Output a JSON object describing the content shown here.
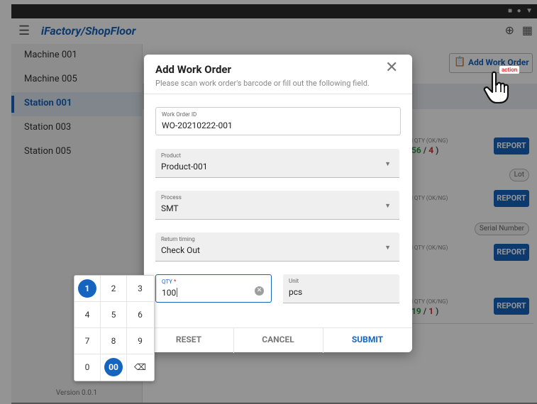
{
  "app": {
    "brand": "iFactory/ShopFloor",
    "version": "Version 0.0.1"
  },
  "sidebar": {
    "items": [
      {
        "label": "Machine 001",
        "active": false
      },
      {
        "label": "Machine 005",
        "active": false
      },
      {
        "label": "Station 001",
        "active": true
      },
      {
        "label": "Station 003",
        "active": false
      },
      {
        "label": "Station 005",
        "active": false
      }
    ]
  },
  "main": {
    "add_button": "Add Work Order",
    "cards": [
      {
        "qty_label": "l QTY (OK/NG)",
        "ok": "56",
        "ng": "4",
        "sep": "/",
        "open": "",
        "close": ")",
        "report": "REPORT",
        "pill": ""
      },
      {
        "qty_label": "l QTY (OK/NG)",
        "ok": "",
        "ng": "",
        "sep": "",
        "open": "",
        "close": "",
        "report": "REPORT",
        "pill": "Lot"
      },
      {
        "qty_label": "l QTY (OK/NG)",
        "ok": "",
        "ng": "",
        "sep": "",
        "open": "",
        "close": "",
        "report": "REPORT",
        "pill": "Serial Number"
      },
      {
        "qty_label": "l QTY (OK/NG)",
        "ok": "19",
        "ng": "1",
        "sep": "/",
        "open": "",
        "close": ")",
        "report": "REPORT",
        "pill": ""
      }
    ]
  },
  "dialog": {
    "title": "Add Work Order",
    "subtitle": "Please scan work order's barcode or fill out the following field.",
    "fields": {
      "work_order_id": {
        "label": "Work Order ID",
        "value": "WO-20210222-001"
      },
      "product": {
        "label": "Product",
        "value": "Product-001"
      },
      "process": {
        "label": "Process",
        "value": "SMT"
      },
      "return_timing": {
        "label": "Return timing",
        "value": "Check Out"
      },
      "qty": {
        "label": "QTY",
        "required_mark": "*",
        "value": "100"
      },
      "unit": {
        "label": "Unit",
        "value": "pcs"
      }
    },
    "buttons": {
      "reset": "RESET",
      "cancel": "CANCEL",
      "submit": "SUBMIT"
    }
  },
  "numpad": {
    "keys": [
      "1",
      "2",
      "3",
      "4",
      "5",
      "6",
      "7",
      "8",
      "9",
      "0",
      "00",
      "⌫"
    ],
    "highlighted": [
      "1",
      "00"
    ]
  },
  "cursor_label": "action",
  "colors": {
    "primary": "#1565c0",
    "ok": "#2e9b43",
    "ng": "#d32f2f",
    "overlay": "rgba(0,0,0,0.42)"
  },
  "icons": [
    "menu-icon",
    "globe-icon",
    "grid-icon",
    "clipboard-icon",
    "close-icon",
    "dropdown-caret-icon",
    "clear-icon",
    "backspace-icon",
    "hand-pointer-icon"
  ]
}
